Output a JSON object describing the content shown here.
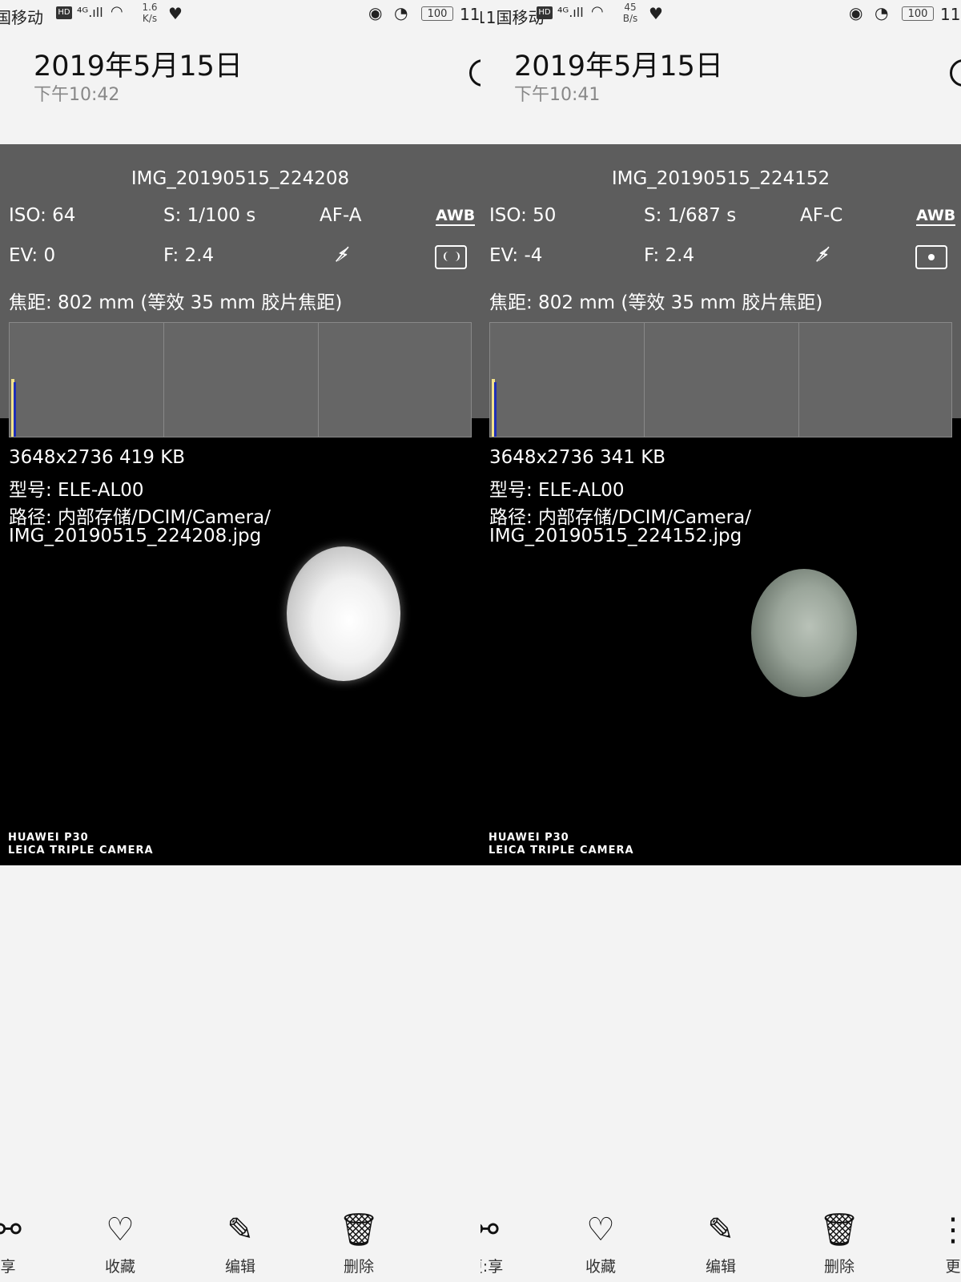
{
  "left": {
    "status": {
      "carrier": "国移动",
      "speed_top": "1.6",
      "speed_bottom": "K/s",
      "battery": "100",
      "time": "11"
    },
    "header": {
      "date": "2019年5月15日",
      "time": "下午10:42"
    },
    "photo": {
      "filename": "IMG_20190515_224208",
      "iso": "ISO: 64",
      "shutter": "S: 1/100 s",
      "af": "AF-A",
      "awb": "AWB",
      "ev": "EV: 0",
      "fnum": "F: 2.4",
      "focal": "焦距: 802 mm (等效 35 mm 胶片焦距)",
      "size": "3648x2736  419 KB",
      "model": "型号:  ELE-AL00",
      "path1": "路径:  内部存储/DCIM/Camera/",
      "path2": "IMG_20190515_224208.jpg",
      "brand1": "HUAWEI P30",
      "brand2": "LEICA TRIPLE CAMERA"
    },
    "toolbar": {
      "share": "享",
      "favorite": "收藏",
      "edit": "编辑",
      "delete": "删除"
    }
  },
  "right": {
    "status": {
      "carrier": "11国移动",
      "speed_top": "45",
      "speed_bottom": "B/s",
      "battery": "100",
      "time": "11"
    },
    "header": {
      "date": "2019年5月15日",
      "time": "下午10:41"
    },
    "photo": {
      "filename": "IMG_20190515_224152",
      "iso": "ISO: 50",
      "shutter": "S: 1/687 s",
      "af": "AF-C",
      "awb": "AWB",
      "ev": "EV: -4",
      "fnum": "F: 2.4",
      "focal": "焦距: 802 mm (等效 35 mm 胶片焦距)",
      "size": "3648x2736  341 KB",
      "model": "型号:  ELE-AL00",
      "path1": "路径:  内部存储/DCIM/Camera/",
      "path2": "IMG_20190515_224152.jpg",
      "brand1": "HUAWEI P30",
      "brand2": "LEICA TRIPLE CAMERA"
    },
    "toolbar": {
      "share": "更:享",
      "favorite": "收藏",
      "edit": "编辑",
      "delete": "删除",
      "more": "更"
    }
  }
}
